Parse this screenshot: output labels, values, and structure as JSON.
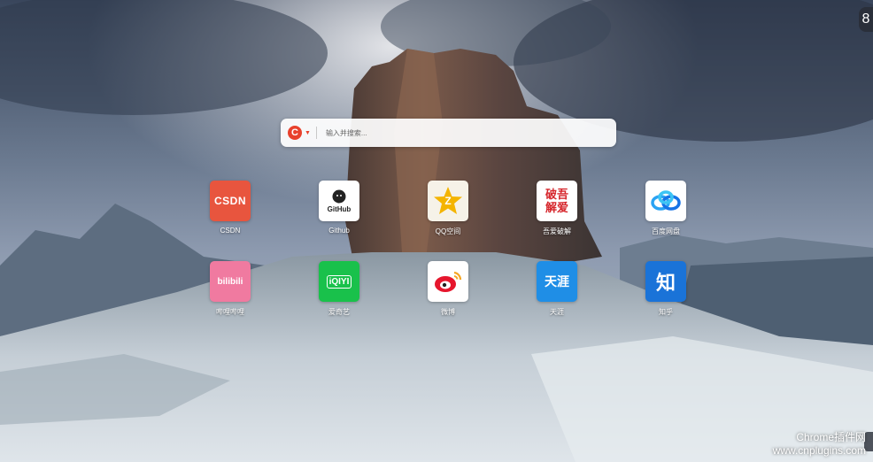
{
  "top_button": {
    "label": "8"
  },
  "search": {
    "engine_icon": "engine-logo-icon",
    "engine_letter": "C",
    "placeholder": "输入并搜索..."
  },
  "tiles": [
    {
      "label": "CSDN",
      "icon_text": "CSDN",
      "color": "#e8553e"
    },
    {
      "label": "Github",
      "icon_text": "GitHub",
      "color": "#ffffff"
    },
    {
      "label": "QQ空间",
      "icon_text": "Z",
      "color": "#f6f2e8"
    },
    {
      "label": "吾爱破解",
      "icon_text": "破吾解爱",
      "color": "#ffffff"
    },
    {
      "label": "百度网盘",
      "icon_text": "",
      "color": "#ffffff"
    },
    {
      "label": "哔哩哔哩",
      "icon_text": "bilibili",
      "color": "#f07aa0"
    },
    {
      "label": "爱奇艺",
      "icon_text": "iQIYI",
      "color": "#19c14b"
    },
    {
      "label": "微博",
      "icon_text": "",
      "color": "#ffffff"
    },
    {
      "label": "天涯",
      "icon_text": "天涯",
      "color": "#1f8ee6"
    },
    {
      "label": "知乎",
      "icon_text": "知",
      "color": "#1a73d8"
    }
  ],
  "watermark": {
    "line1": "Chrome插件网",
    "line2": "www.cnplugins.com"
  }
}
